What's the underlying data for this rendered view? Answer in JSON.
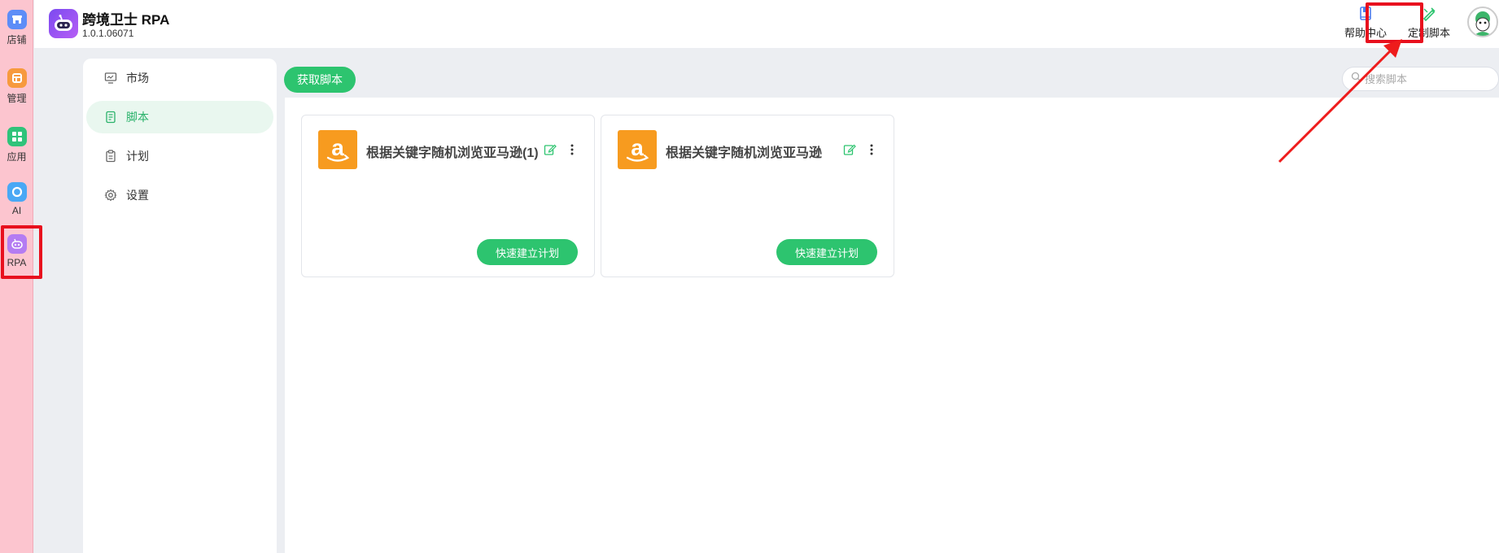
{
  "rail": {
    "items": [
      {
        "label": "店铺",
        "icon": "store-icon"
      },
      {
        "label": "管理",
        "icon": "manage-icon"
      },
      {
        "label": "应用",
        "icon": "apps-icon"
      },
      {
        "label": "AI",
        "icon": "ai-icon"
      },
      {
        "label": "RPA",
        "icon": "robot-icon"
      }
    ],
    "active": "RPA"
  },
  "header": {
    "app_title": "跨境卫士 RPA",
    "version": "1.0.1.06071",
    "help_label": "帮助中心",
    "custom_script_label": "定制脚本"
  },
  "subnav": {
    "items": [
      {
        "label": "市场",
        "icon": "monitor-icon"
      },
      {
        "label": "脚本",
        "icon": "script-icon"
      },
      {
        "label": "计划",
        "icon": "clipboard-icon"
      },
      {
        "label": "设置",
        "icon": "gear-icon"
      }
    ],
    "active": "脚本"
  },
  "toolbar": {
    "get_script_label": "获取脚本",
    "search_placeholder": "搜索脚本"
  },
  "scripts": [
    {
      "title": "根据关键字随机浏览亚马逊(1)",
      "icon": "amazon-icon",
      "action_label": "快速建立计划"
    },
    {
      "title": "根据关键字随机浏览亚马逊",
      "icon": "amazon-icon",
      "action_label": "快速建立计划"
    }
  ],
  "colors": {
    "accent": "#2dc46f",
    "rail_bg": "#fcc5cf",
    "highlight": "#e8101e",
    "amazon": "#f79b1f"
  }
}
